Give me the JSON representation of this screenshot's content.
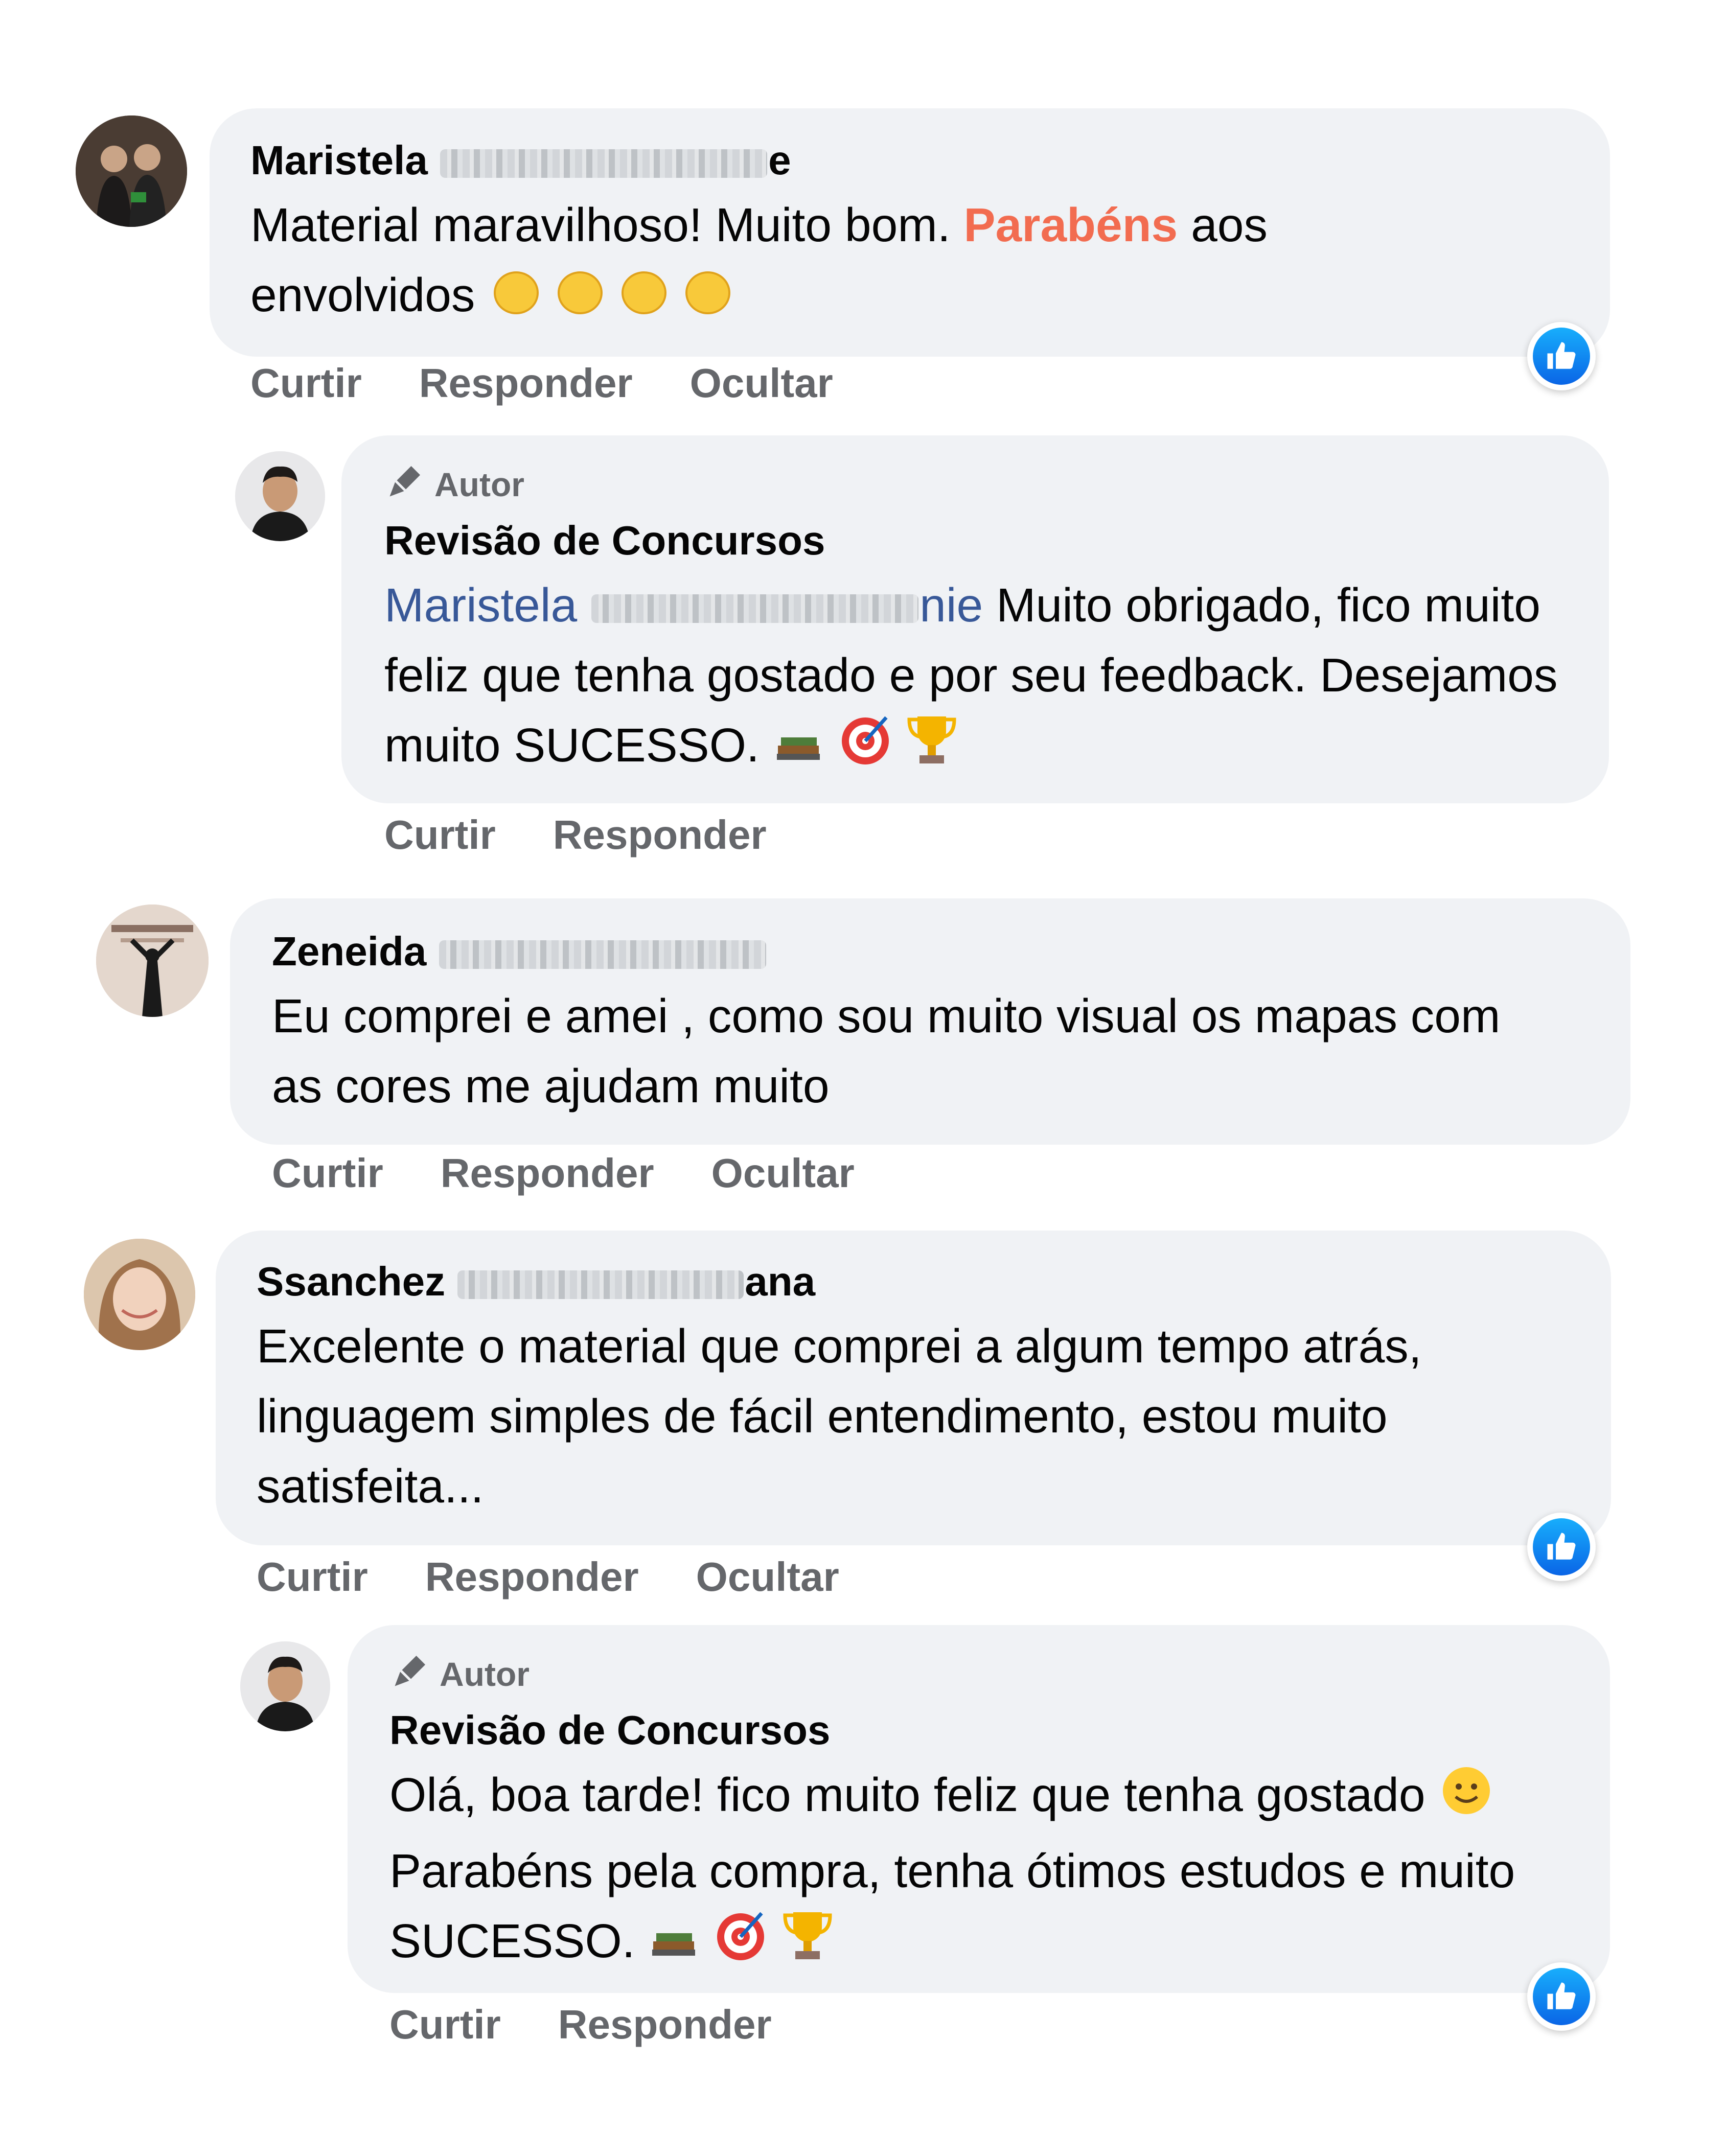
{
  "comments": [
    {
      "author_first": "Maristela",
      "author_suffix": "e",
      "text_before": "Material maravilhoso! Muito bom. ",
      "text_highlight": "Parabéns",
      "text_after": " aos envolvidos",
      "actions": [
        "Curtir",
        "Responder",
        "Ocultar"
      ]
    },
    {
      "badge": "Autor",
      "author": "Revisão de Concursos",
      "mention_first": "Maristela",
      "mention_suffix": "nie",
      "text": " Muito obrigado, fico muito feliz que tenha gostado e por seu feedback. Desejamos muito SUCESSO.",
      "actions": [
        "Curtir",
        "Responder"
      ]
    },
    {
      "author_first": "Zeneida",
      "text": "Eu comprei e amei , como sou muito visual os mapas com as cores me ajudam muito",
      "actions": [
        "Curtir",
        "Responder",
        "Ocultar"
      ]
    },
    {
      "author_first": "Ssanchez",
      "author_suffix": "ana",
      "text": "Excelente o material que comprei a algum tempo atrás, linguagem simples de fácil entendimento, estou muito satisfeita...",
      "actions": [
        "Curtir",
        "Responder",
        "Ocultar"
      ]
    },
    {
      "badge": "Autor",
      "author": "Revisão de Concursos",
      "text_before": "Olá, boa tarde! fico muito feliz que tenha gostado ",
      "text_after": " Parabéns pela compra, tenha ótimos estudos e muito SUCESSO.",
      "actions": [
        "Curtir",
        "Responder"
      ]
    }
  ],
  "colors": {
    "bubble": "#f0f2f5",
    "action_text": "#65676b",
    "mention": "#385898",
    "highlight": "#f26c50",
    "like_blue": "#0a65e6"
  },
  "icons": {
    "badge": "pen-icon",
    "reaction": "thumbs-up-icon",
    "emojis": [
      "clapping-hands-icon",
      "books-icon",
      "target-icon",
      "trophy-icon",
      "smiley-icon"
    ]
  }
}
